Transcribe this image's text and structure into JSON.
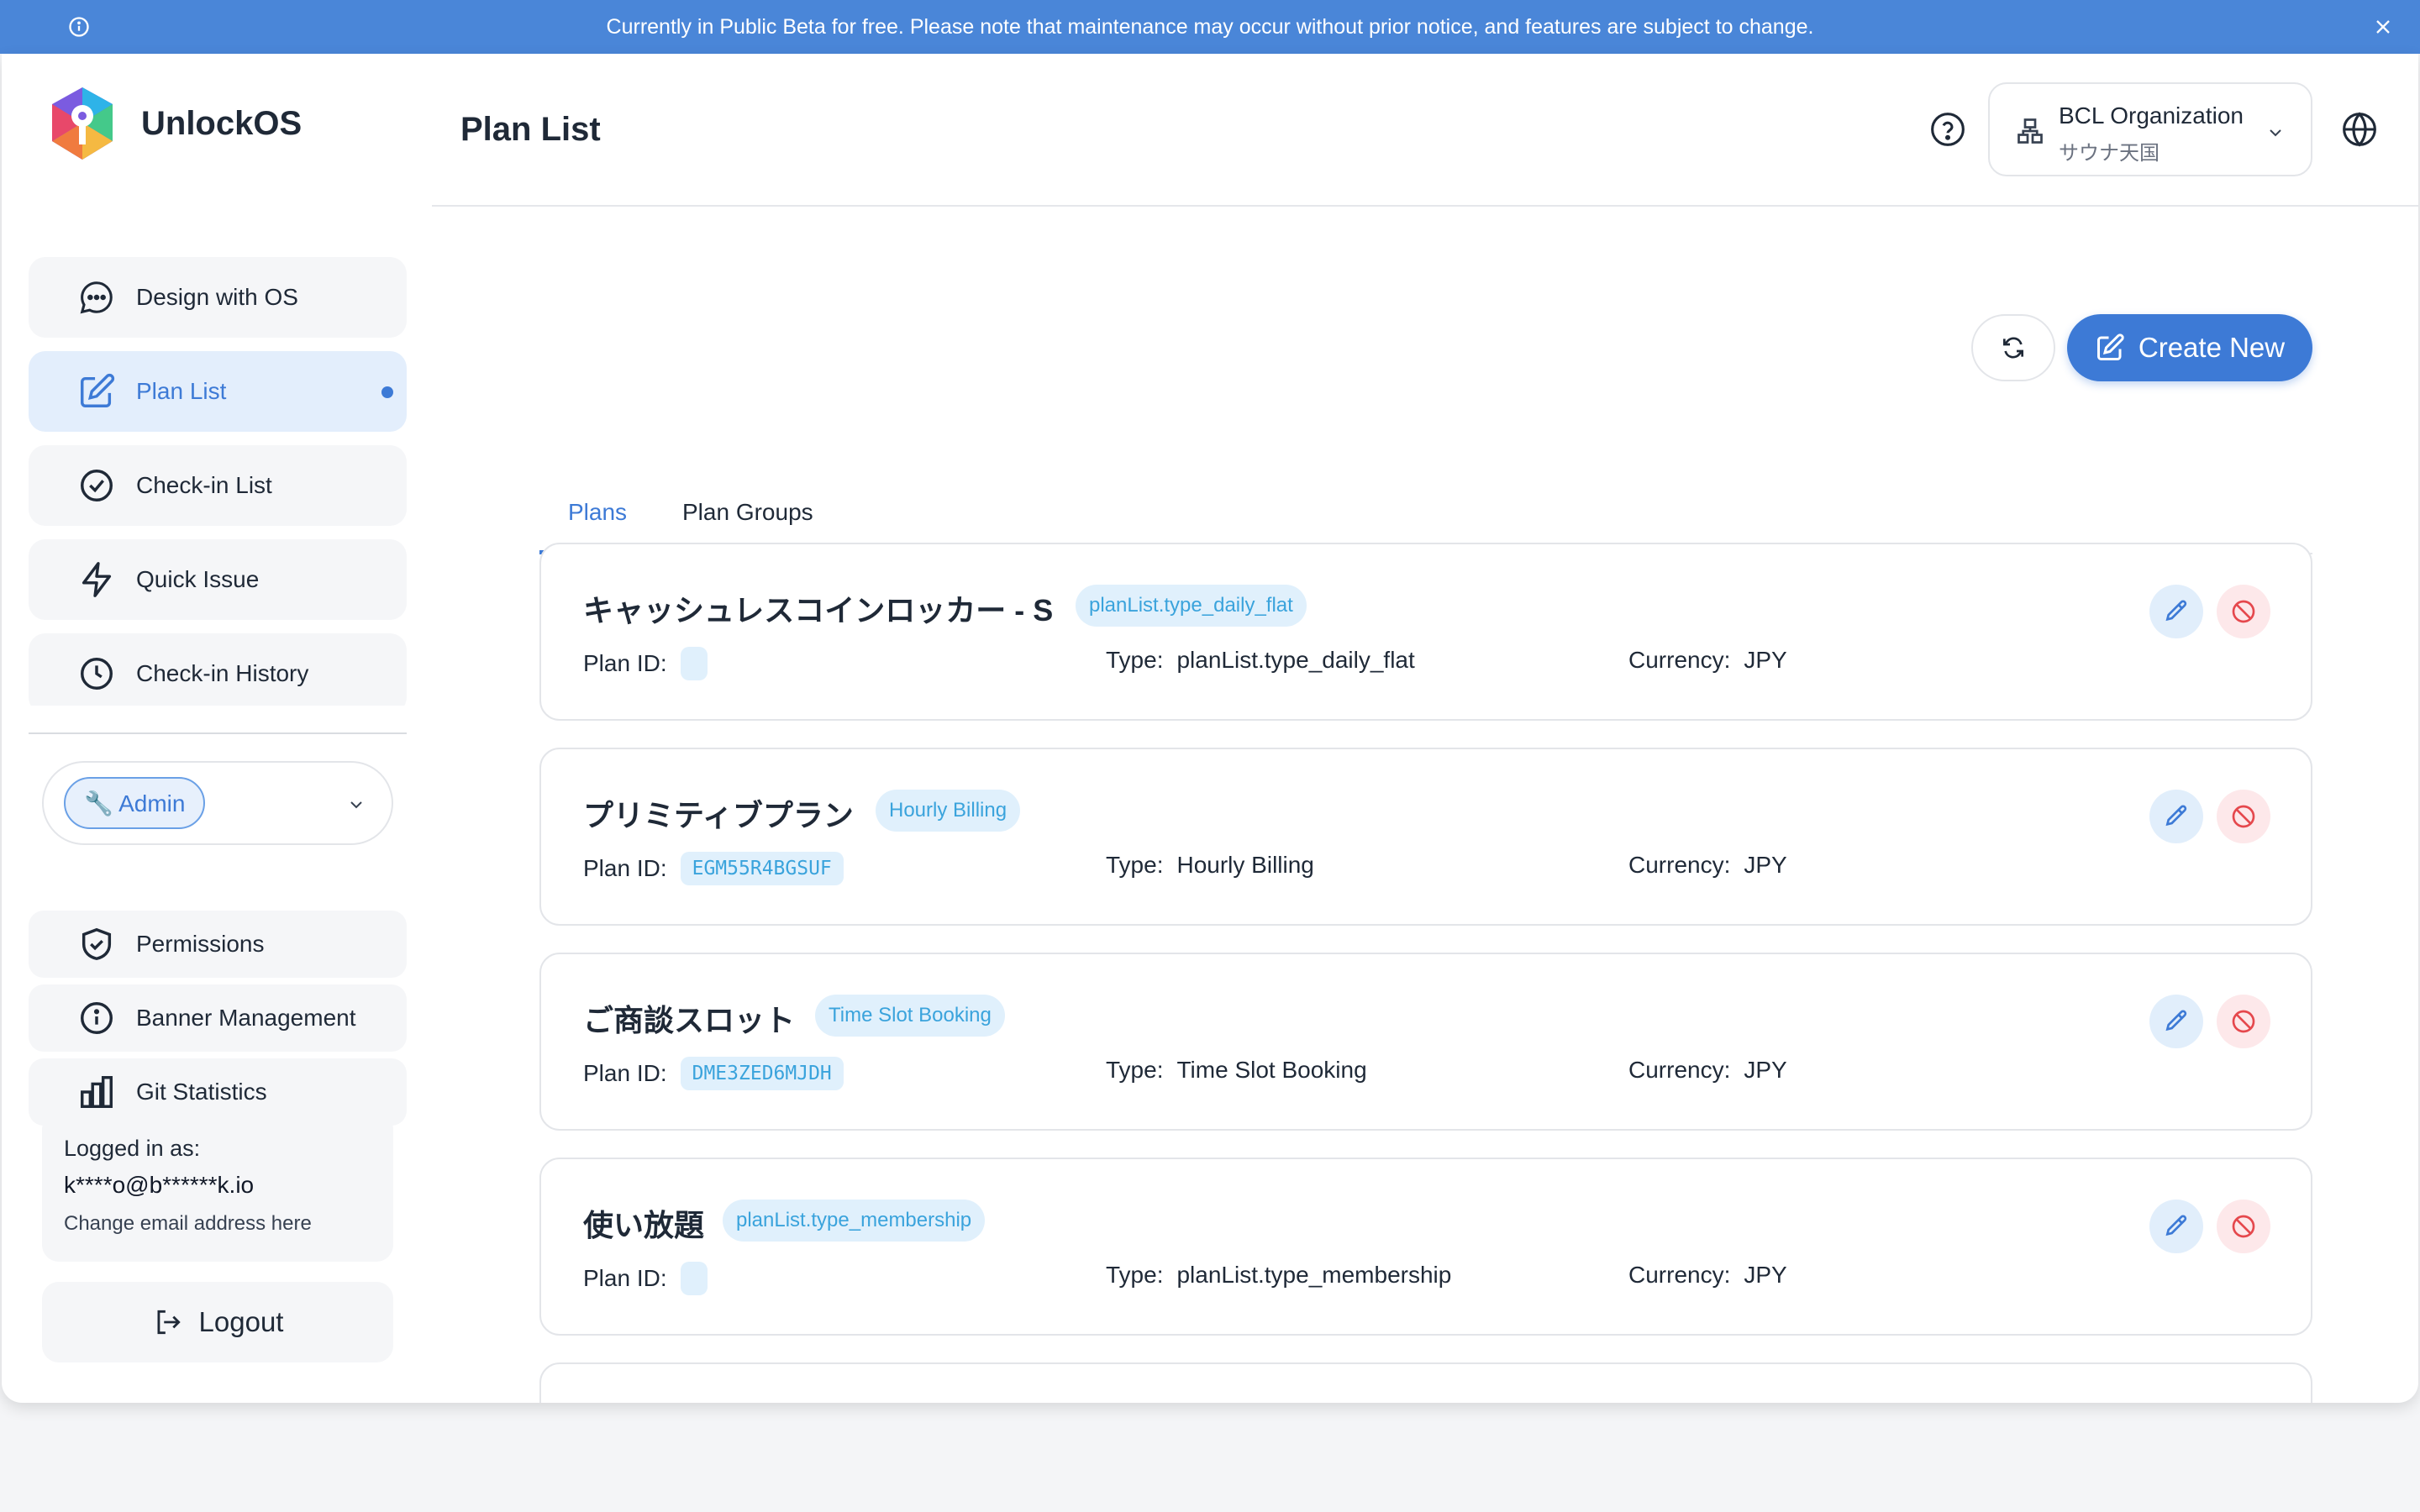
{
  "banner": {
    "text": "Currently in Public Beta for free. Please note that maintenance may occur without prior notice, and features are subject to change."
  },
  "brand": {
    "name": "UnlockOS"
  },
  "sidebar": {
    "items": [
      {
        "label": "Design with OS",
        "icon": "chat-icon"
      },
      {
        "label": "Plan List",
        "icon": "edit-icon",
        "active": true
      },
      {
        "label": "Check-in List",
        "icon": "check-circle-icon"
      },
      {
        "label": "Quick Issue",
        "icon": "lightning-icon"
      },
      {
        "label": "Check-in History",
        "icon": "clock-icon"
      }
    ],
    "role": "🔧 Admin",
    "admin_items": [
      {
        "label": "Permissions",
        "icon": "shield-check-icon"
      },
      {
        "label": "Banner Management",
        "icon": "info-icon"
      },
      {
        "label": "Git Statistics",
        "icon": "bar-chart-icon"
      }
    ],
    "login": {
      "label": "Logged in as:",
      "email": "k****o@b******k.io",
      "change": "Change email address here"
    },
    "logout": "Logout"
  },
  "header": {
    "title": "Plan List",
    "org_name": "BCL Organization",
    "org_sub": "サウナ天国"
  },
  "toolbar": {
    "create_label": "Create New"
  },
  "tabs": [
    "Plans",
    "Plan Groups"
  ],
  "field_labels": {
    "plan_id": "Plan ID:",
    "type": "Type:",
    "currency": "Currency:"
  },
  "plans": [
    {
      "name": "キャッシュレスコインロッカー - S",
      "badge": "planList.type_daily_flat",
      "plan_id": "",
      "type": "planList.type_daily_flat",
      "currency": "JPY"
    },
    {
      "name": "プリミティブプラン",
      "badge": "Hourly Billing",
      "plan_id": "EGM55R4BGSUF",
      "type": "Hourly Billing",
      "currency": "JPY"
    },
    {
      "name": "ご商談スロット",
      "badge": "Time Slot Booking",
      "plan_id": "DME3ZED6MJDH",
      "type": "Time Slot Booking",
      "currency": "JPY"
    },
    {
      "name": "使い放題",
      "badge": "planList.type_membership",
      "plan_id": "",
      "type": "planList.type_membership",
      "currency": "JPY"
    }
  ],
  "colors": {
    "accent": "#3d7ad6",
    "banner": "#4a86d8",
    "badge_bg": "#e0f0fc",
    "danger": "#e5484d"
  }
}
